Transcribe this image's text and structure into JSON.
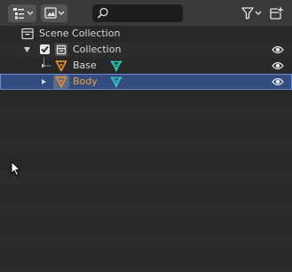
{
  "header": {
    "display_mode_icon": "outliner-view-layer-icon",
    "filter_icon": "image-filter-icon",
    "search": {
      "value": "",
      "placeholder": ""
    },
    "funnel_icon": "funnel-icon",
    "new_collection_icon": "new-collection-icon"
  },
  "tree": {
    "scene_collection": {
      "label": "Scene Collection"
    },
    "collection": {
      "label": "Collection",
      "checked": true,
      "expanded": true
    },
    "objects": [
      {
        "label": "Base",
        "selected": false,
        "visible": true
      },
      {
        "label": "Body",
        "selected": true,
        "visible": true
      }
    ]
  },
  "colors": {
    "header_bg": "#3a3a3a",
    "panel_bg": "#282828",
    "selection": "#334d80",
    "object_icon": "#e48a3a",
    "mesh_data_icon": "#2ec4b6",
    "selected_text": "#f0a040"
  }
}
